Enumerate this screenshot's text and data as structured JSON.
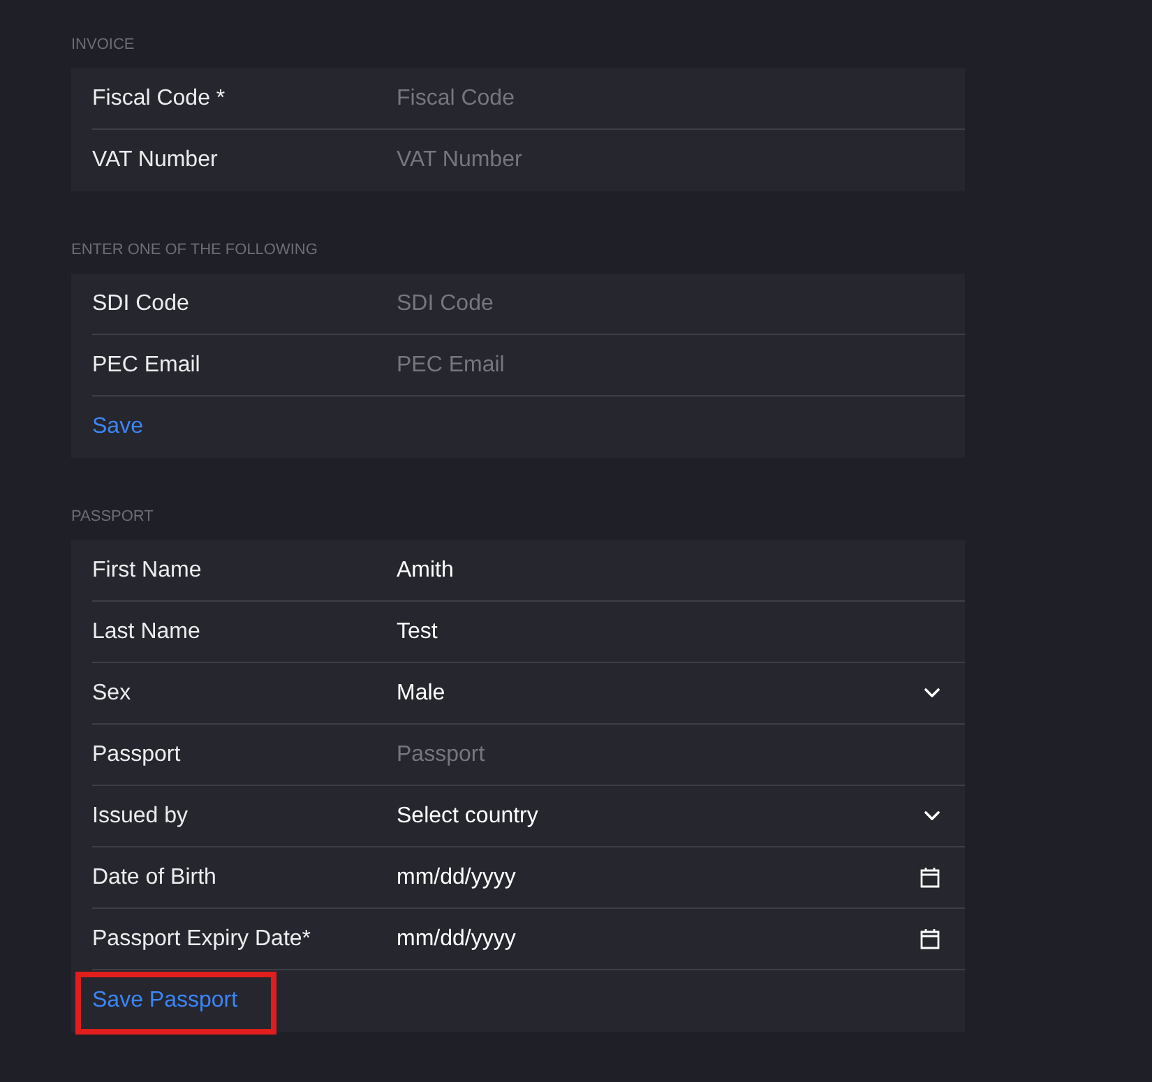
{
  "sections": [
    {
      "title": "INVOICE",
      "fields": [
        {
          "kind": "text",
          "label": "Fiscal Code *",
          "placeholder": "Fiscal Code"
        },
        {
          "kind": "text",
          "label": "VAT Number",
          "placeholder": "VAT Number"
        }
      ]
    },
    {
      "title": "ENTER ONE OF THE FOLLOWING",
      "fields": [
        {
          "kind": "text",
          "label": "SDI Code",
          "placeholder": "SDI Code"
        },
        {
          "kind": "text",
          "label": "PEC Email",
          "placeholder": "PEC Email"
        }
      ],
      "action": {
        "label": "Save",
        "highlighted": false
      }
    },
    {
      "title": "PASSPORT",
      "fields": [
        {
          "kind": "text",
          "label": "First Name",
          "value": "Amith"
        },
        {
          "kind": "text",
          "label": "Last Name",
          "value": "Test"
        },
        {
          "kind": "select",
          "label": "Sex",
          "value": "Male"
        },
        {
          "kind": "text",
          "label": "Passport",
          "placeholder": "Passport"
        },
        {
          "kind": "select",
          "label": "Issued by",
          "value": "Select country"
        },
        {
          "kind": "date",
          "label": "Date of Birth",
          "placeholder": "mm/dd/yyyy"
        },
        {
          "kind": "date",
          "label": "Passport Expiry Date*",
          "placeholder": "mm/dd/yyyy"
        }
      ],
      "action": {
        "label": "Save Passport",
        "highlighted": true
      }
    }
  ]
}
